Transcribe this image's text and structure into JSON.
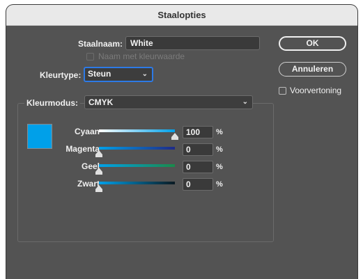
{
  "window": {
    "title": "Staalopties"
  },
  "form": {
    "swatch_name_label": "Staalnaam:",
    "swatch_name_value": "White",
    "name_with_value_label": "Naam met kleurwaarde",
    "color_type_label": "Kleurtype:",
    "color_type_value": "Steun",
    "color_mode_label": "Kleurmodus:",
    "color_mode_value": "CMYK"
  },
  "buttons": {
    "ok": "OK",
    "cancel": "Annuleren"
  },
  "preview": {
    "label": "Voorvertoning",
    "checked": false
  },
  "swatch_color": "#00a0e9",
  "sliders": [
    {
      "label": "Cyaan",
      "value": "100",
      "unit": "%",
      "fraction": 1.0,
      "gradient_from": "#ffffff",
      "gradient_to": "#00a0e9"
    },
    {
      "label": "Magenta",
      "value": "0",
      "unit": "%",
      "fraction": 0.0,
      "gradient_from": "#00a0e9",
      "gradient_to": "#1f2a87"
    },
    {
      "label": "Geel",
      "value": "0",
      "unit": "%",
      "fraction": 0.0,
      "gradient_from": "#00a0e9",
      "gradient_to": "#1a8a4a"
    },
    {
      "label": "Zwart",
      "value": "0",
      "unit": "%",
      "fraction": 0.0,
      "gradient_from": "#00a0e9",
      "gradient_to": "#0b1a22"
    }
  ]
}
